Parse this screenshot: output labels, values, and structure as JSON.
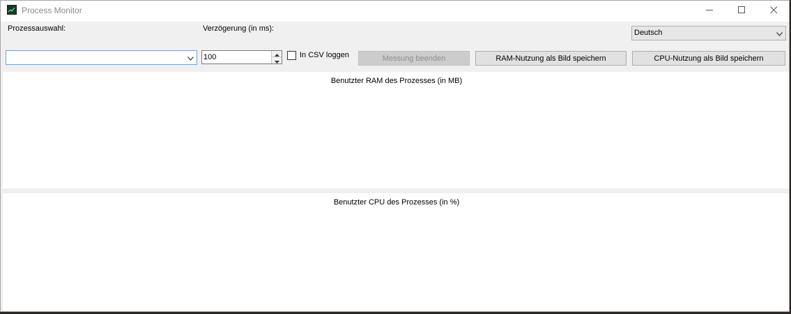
{
  "window": {
    "title": "Process Monitor",
    "icons": {
      "app": "process-monitor-icon",
      "minimize": "minimize-icon",
      "maximize": "maximize-icon",
      "close": "close-icon"
    }
  },
  "controls": {
    "process_label": "Prozessauswahl:",
    "process_value": "",
    "delay_label": "Verzögerung (in ms):",
    "delay_value": "100",
    "csv_label": "In CSV loggen",
    "csv_checked": false,
    "language_value": "Deutsch",
    "stop_button": "Messung beenden",
    "save_ram_button": "RAM-Nutzung als Bild speichern",
    "save_cpu_button": "CPU-Nutzung als Bild speichern"
  },
  "charts": {
    "ram_title": "Benutzter RAM des Prozesses (in MB)",
    "cpu_title": "Benutzter CPU des Prozesses (in %)"
  }
}
